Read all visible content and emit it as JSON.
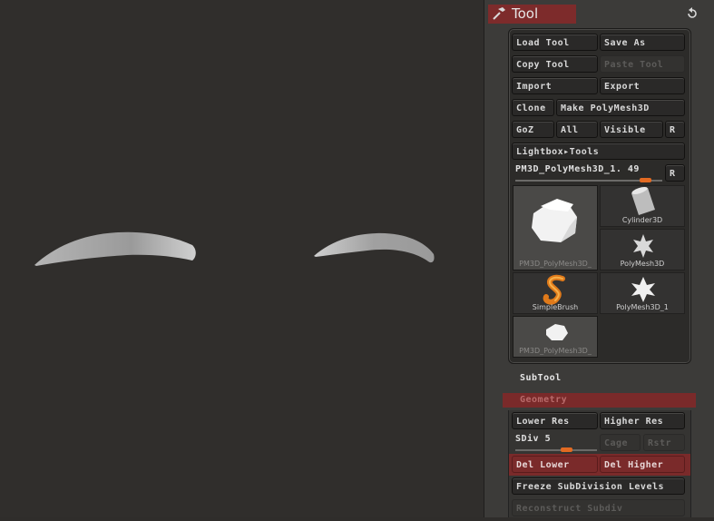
{
  "title": "Tool",
  "buttons": {
    "load_tool": "Load Tool",
    "save_as": "Save As",
    "copy_tool": "Copy Tool",
    "paste_tool": "Paste Tool",
    "import": "Import",
    "export": "Export",
    "clone": "Clone",
    "make_polymesh": "Make PolyMesh3D",
    "goz": "GoZ",
    "all": "All",
    "visible": "Visible",
    "r": "R",
    "lightbox_tools": "Lightbox▸Tools"
  },
  "current_tool": {
    "name": "PM3D_PolyMesh3D_1.",
    "value": "49",
    "slider_fraction": 0.88
  },
  "tools": [
    {
      "label": "PM3D_PolyMesh3D_",
      "icon": "mesh-blob-icon"
    },
    {
      "label": "Cylinder3D",
      "icon": "cylinder-icon"
    },
    {
      "label": "PolyMesh3D",
      "icon": "star-icon"
    },
    {
      "label": "SimpleBrush",
      "icon": "simplebrush-icon"
    },
    {
      "label": "PolyMesh3D_1",
      "icon": "star-icon"
    },
    {
      "label": "PM3D_PolyMesh3D_",
      "icon": "mesh-blob-icon"
    }
  ],
  "subtool": "SubTool",
  "geometry": {
    "title": "Geometry",
    "lower_res": "Lower Res",
    "higher_res": "Higher Res",
    "sdiv_label": "SDiv",
    "sdiv_value": "5",
    "sdiv_fraction": 0.62,
    "cage": "Cage",
    "rstr": "Rstr",
    "del_lower": "Del Lower",
    "del_higher": "Del Higher",
    "freeze": "Freeze SubDivision Levels",
    "reconstruct": "Reconstruct Subdiv"
  },
  "colors": {
    "accent_red": "#7a2a2a",
    "slider_orange": "#e26a22"
  }
}
